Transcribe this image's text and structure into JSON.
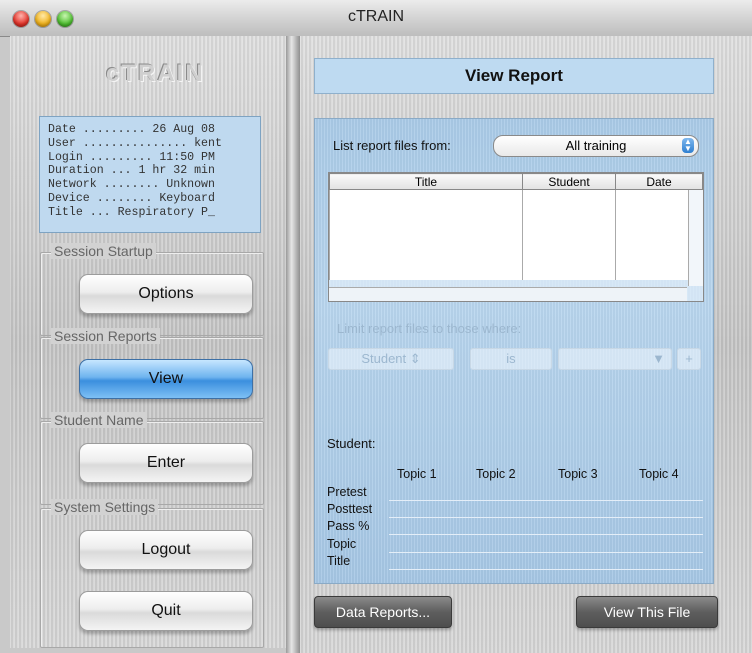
{
  "window": {
    "title": "cTRAIN"
  },
  "left": {
    "logo": "cTRAIN",
    "info_lines": [
      "Date ......... 26 Aug 08",
      "User ............... kent",
      "Login ......... 11:50 PM",
      "Duration ... 1 hr 32 min",
      "Network ........ Unknown",
      "Device ........ Keyboard",
      "Title ... Respiratory P_"
    ],
    "groups": [
      {
        "label": "Session Startup",
        "button": "Options"
      },
      {
        "label": "Session Reports",
        "button": "View"
      },
      {
        "label": "Student Name",
        "button": "Enter"
      },
      {
        "label": "System Settings",
        "button": "Logout"
      }
    ],
    "quit": "Quit"
  },
  "right": {
    "header": "View Report",
    "list_label": "List report files from:",
    "list_value": "All training",
    "table": {
      "columns": [
        "Title",
        "Student",
        "Date"
      ]
    },
    "limit_label": "Limit report files to those where:",
    "filter_field": "Student",
    "filter_op": "is",
    "filter_value": "",
    "add_glyph": "+",
    "student_label": "Student:",
    "topics": [
      "Topic 1",
      "Topic 2",
      "Topic 3",
      "Topic 4"
    ],
    "row_labels": [
      "Pretest",
      "Posttest",
      "Pass %",
      "Topic",
      "Title"
    ],
    "data_reports": "Data Reports...",
    "view_file": "View This File"
  }
}
